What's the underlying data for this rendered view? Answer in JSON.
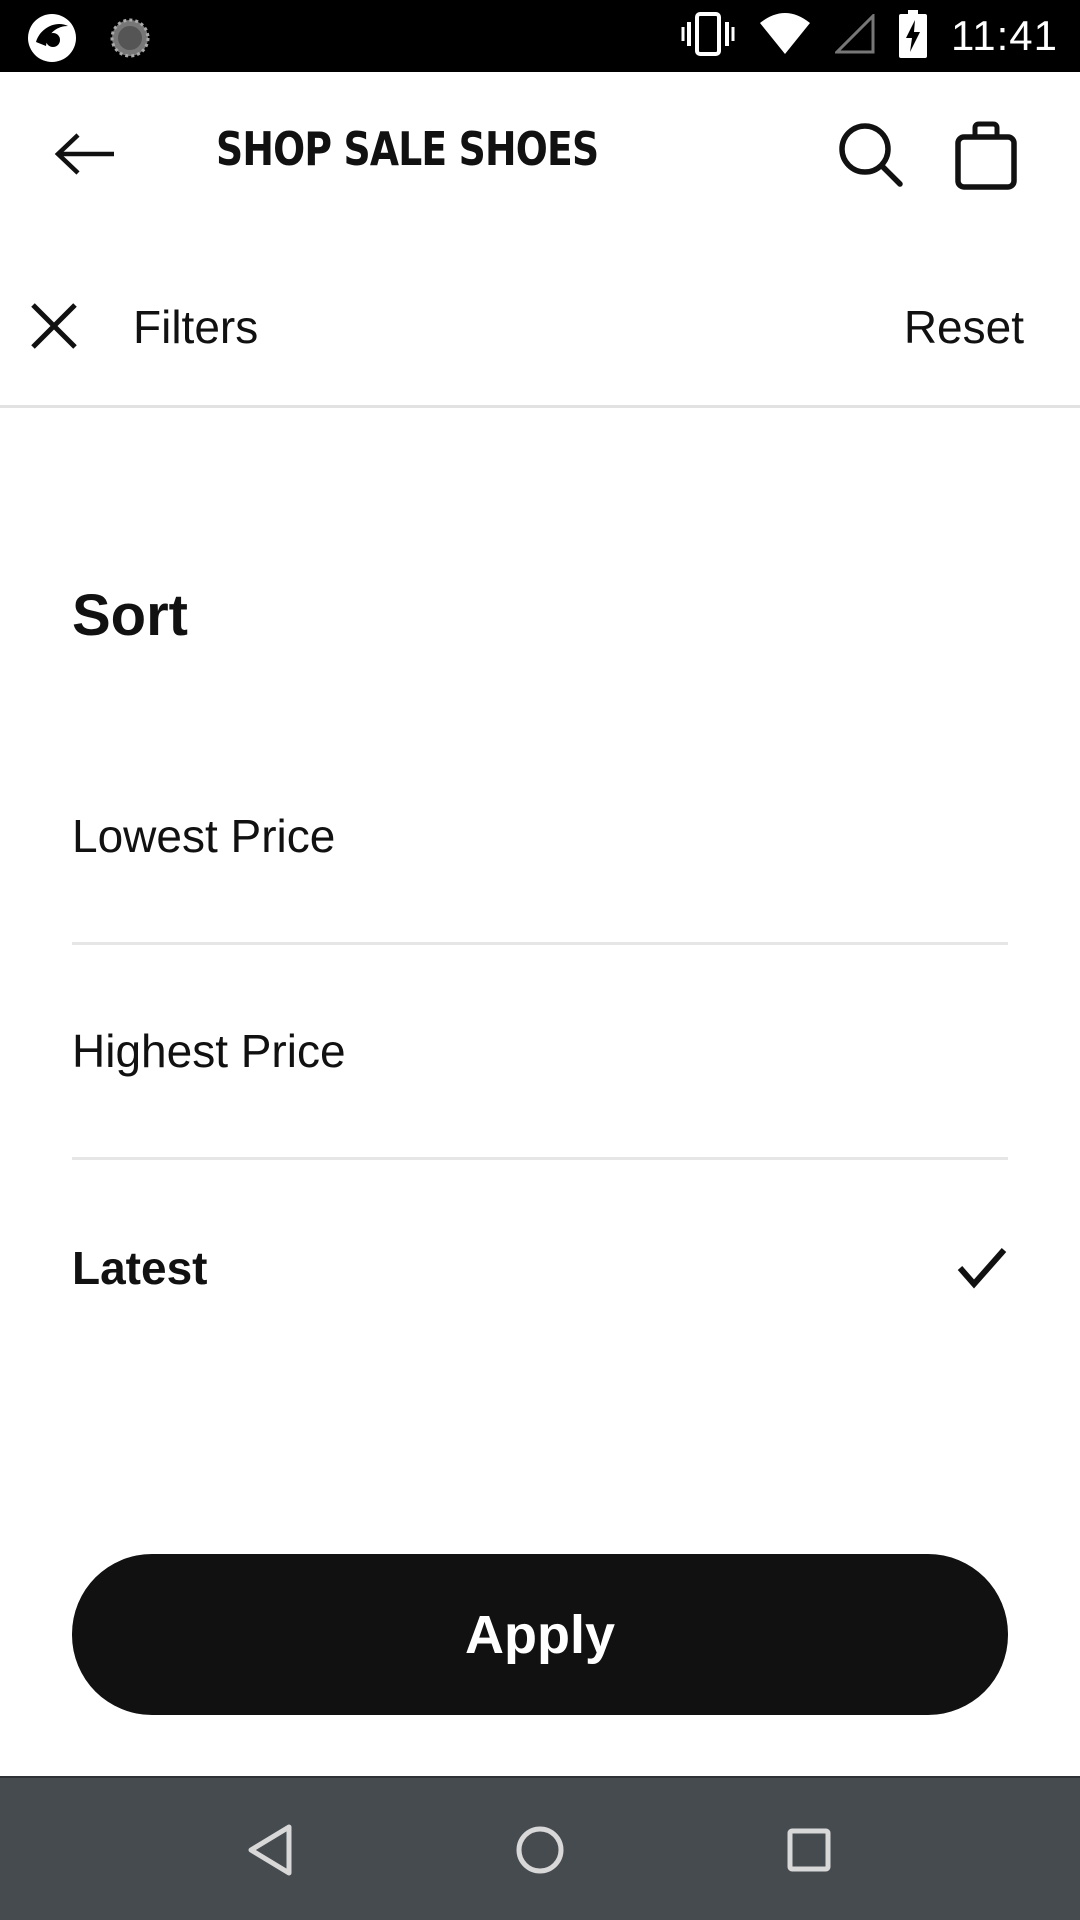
{
  "status_bar": {
    "time": "11:41",
    "left_icons": [
      "app-logo-icon",
      "loading-icon"
    ],
    "right_icons": [
      "vibrate-icon",
      "wifi-icon",
      "cellular-signal-icon",
      "battery-charging-icon"
    ]
  },
  "header": {
    "title": "SHOP SALE SHOES",
    "back_icon": "back-arrow-icon",
    "search_icon": "search-icon",
    "bag_icon": "shopping-bag-icon"
  },
  "filters": {
    "close_icon": "close-icon",
    "title": "Filters",
    "reset_label": "Reset"
  },
  "sort": {
    "heading": "Sort",
    "options": [
      {
        "label": "Lowest Price",
        "selected": false
      },
      {
        "label": "Highest Price",
        "selected": false
      },
      {
        "label": "Latest",
        "selected": true
      }
    ],
    "selected_icon": "checkmark-icon"
  },
  "apply_label": "Apply",
  "nav_bar": {
    "buttons": [
      "nav-back-icon",
      "nav-home-icon",
      "nav-recents-icon"
    ]
  },
  "colors": {
    "status_bar_bg": "#000000",
    "primary_text": "#111111",
    "apply_bg": "#111111",
    "apply_text": "#ffffff",
    "divider": "#e6e6e6",
    "nav_bar_bg": "#464b50"
  }
}
